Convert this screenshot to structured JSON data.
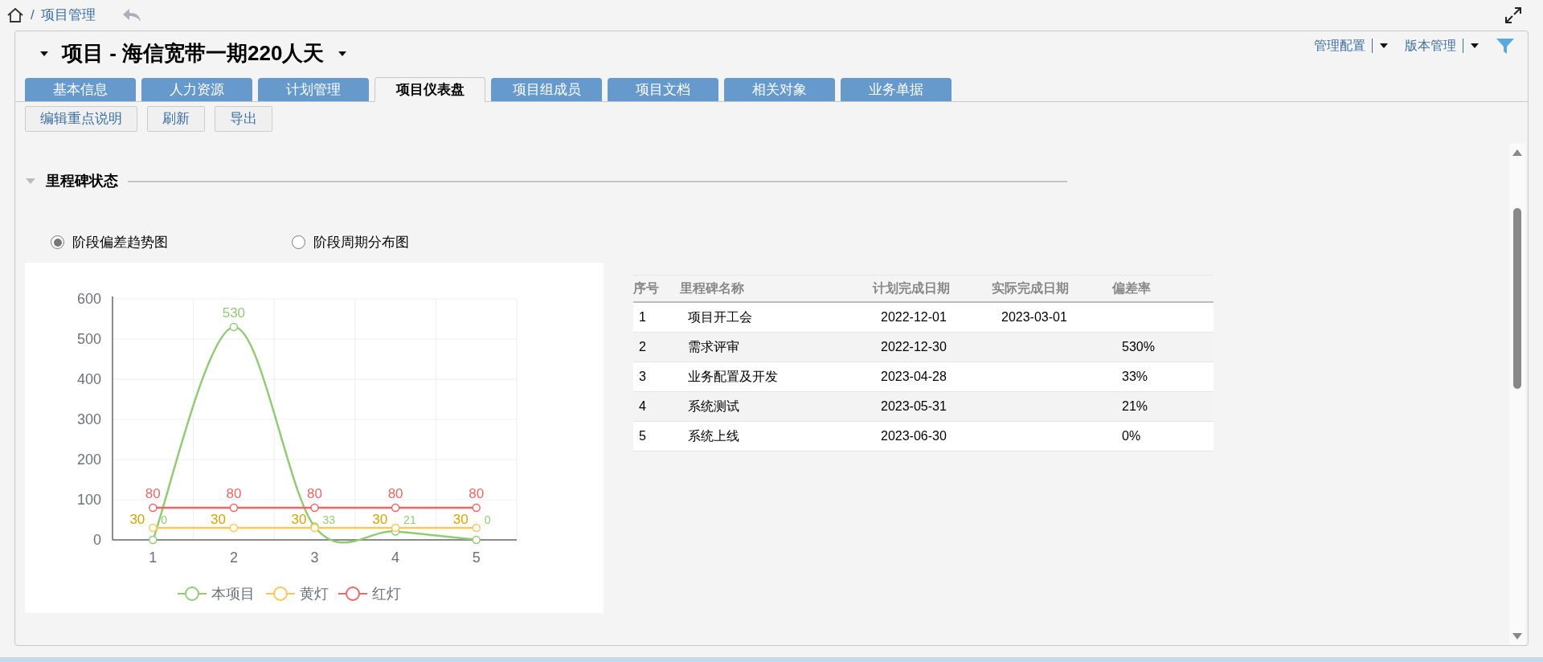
{
  "breadcrumb": {
    "separator": "/",
    "items": [
      "项目管理"
    ]
  },
  "header": {
    "title": "项目 - 海信宽带一期220人天",
    "menus": [
      "管理配置",
      "版本管理"
    ]
  },
  "tabs": [
    {
      "label": "基本信息",
      "selected": false
    },
    {
      "label": "人力资源",
      "selected": false
    },
    {
      "label": "计划管理",
      "selected": false
    },
    {
      "label": "项目仪表盘",
      "selected": true
    },
    {
      "label": "项目组成员",
      "selected": false
    },
    {
      "label": "项目文档",
      "selected": false
    },
    {
      "label": "相关对象",
      "selected": false
    },
    {
      "label": "业务单据",
      "selected": false
    }
  ],
  "actions": [
    "编辑重点说明",
    "刷新",
    "导出"
  ],
  "section": {
    "title": "里程碑状态",
    "expanded": true
  },
  "chart_options": [
    {
      "label": "阶段偏差趋势图",
      "selected": true
    },
    {
      "label": "阶段周期分布图",
      "selected": false
    }
  ],
  "chart": {
    "chart_data": {
      "type": "line",
      "categories": [
        "1",
        "2",
        "3",
        "4",
        "5"
      ],
      "ylim": [
        0,
        600
      ],
      "yticks": [
        0,
        100,
        200,
        300,
        400,
        500,
        600
      ],
      "data_labels": true,
      "grid": true,
      "legend": true,
      "series": [
        {
          "name": "本项目",
          "color": "#91cc75",
          "marker": "circle",
          "values": [
            0,
            530,
            33,
            21,
            0
          ]
        },
        {
          "name": "黄灯",
          "color": "#fac858",
          "marker": "circle",
          "values": [
            30,
            30,
            30,
            30,
            30
          ]
        },
        {
          "name": "红灯",
          "color": "#ee6666",
          "marker": "circle",
          "values": [
            80,
            80,
            80,
            80,
            80
          ]
        }
      ]
    }
  },
  "table": {
    "columns": [
      "序号",
      "里程碑名称",
      "计划完成日期",
      "实际完成日期",
      "偏差率"
    ],
    "rows": [
      [
        "1",
        "项目开工会",
        "2022-12-01",
        "2023-03-01",
        ""
      ],
      [
        "2",
        "需求评审",
        "2022-12-30",
        "",
        "530%"
      ],
      [
        "3",
        "业务配置及开发",
        "2023-04-28",
        "",
        "33%"
      ],
      [
        "4",
        "系统测试",
        "2023-05-31",
        "",
        "21%"
      ],
      [
        "5",
        "系统上线",
        "2023-06-30",
        "",
        "0%"
      ]
    ]
  }
}
